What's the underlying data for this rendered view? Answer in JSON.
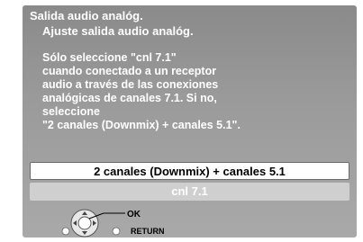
{
  "menu": {
    "title": "Salida audio analóg.",
    "subtitle": "Ajuste salida audio analóg.",
    "message_lines": [
      "Sólo seleccione \"cnl 7.1\"",
      "cuando conectado a un receptor",
      "audio a través de las conexiones",
      "analógicas de canales 7.1. Si no,",
      "seleccione",
      "\"2 canales (Downmix) + canales 5.1\"."
    ],
    "options": [
      {
        "label": "2 canales (Downmix) + canales 5.1",
        "selected": true
      },
      {
        "label": "cnl 7.1",
        "selected": false
      }
    ]
  },
  "controls": {
    "ok_label": "OK",
    "return_label": "RETURN",
    "ok_icon": "navigation-pad-icon",
    "return_icon": "return-button-icon"
  },
  "colors": {
    "panel_top": "#8a8a8a",
    "panel_bottom": "#a9a9a9",
    "selected_bg": "#ffffff",
    "unselected_bg": "#cfcfcf",
    "text": "#ffffff"
  }
}
